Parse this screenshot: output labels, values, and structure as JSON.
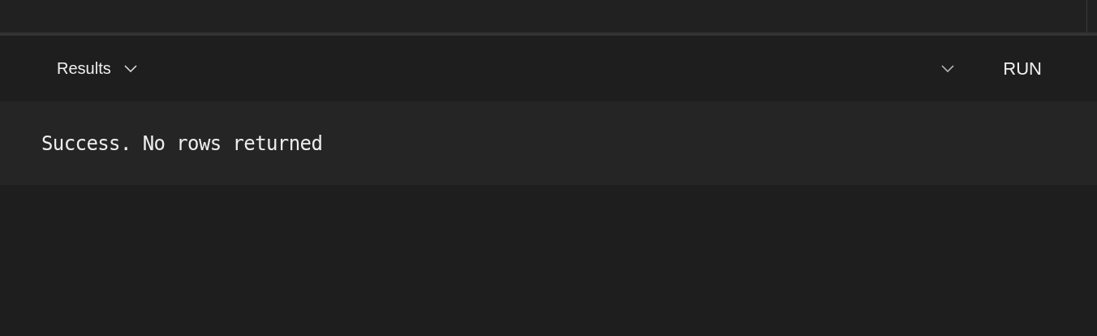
{
  "toolbar": {
    "view_selector": "Results",
    "run_button": "RUN"
  },
  "result_message": "Success. No rows returned"
}
